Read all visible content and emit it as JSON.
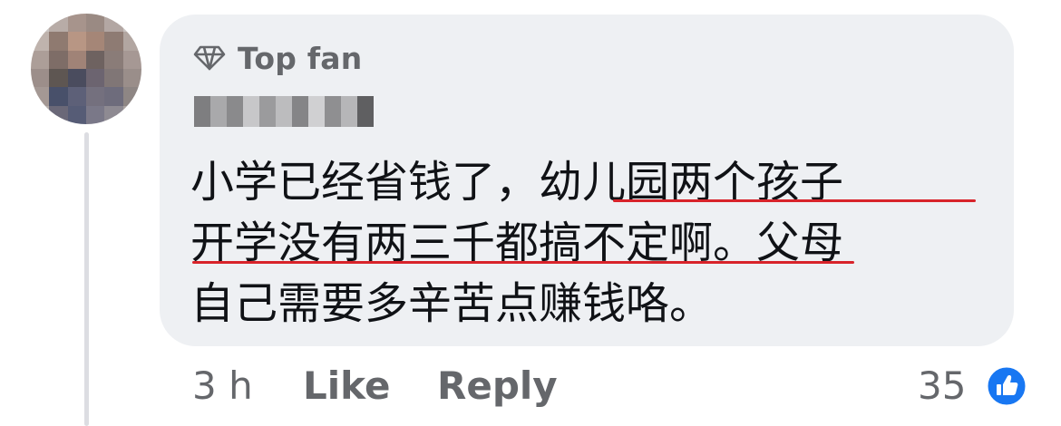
{
  "comment": {
    "badge": {
      "label": "Top fan",
      "icon": "diamond-icon"
    },
    "lines": [
      "小学已经省钱了，幼儿园两个孩子",
      "开学没有两三千都搞不定啊。父母",
      "自己需要多辛苦点赚钱咯。"
    ],
    "highlight_color": "#d8232a"
  },
  "actions": {
    "time": "3 h",
    "like_label": "Like",
    "reply_label": "Reply",
    "reaction_count": "35",
    "reaction_icon": "thumbs-up-icon"
  },
  "colors": {
    "bubble_bg": "#eef0f3",
    "secondary_text": "#65676b",
    "primary_text": "#101216",
    "like_blue": "#1877f2"
  }
}
